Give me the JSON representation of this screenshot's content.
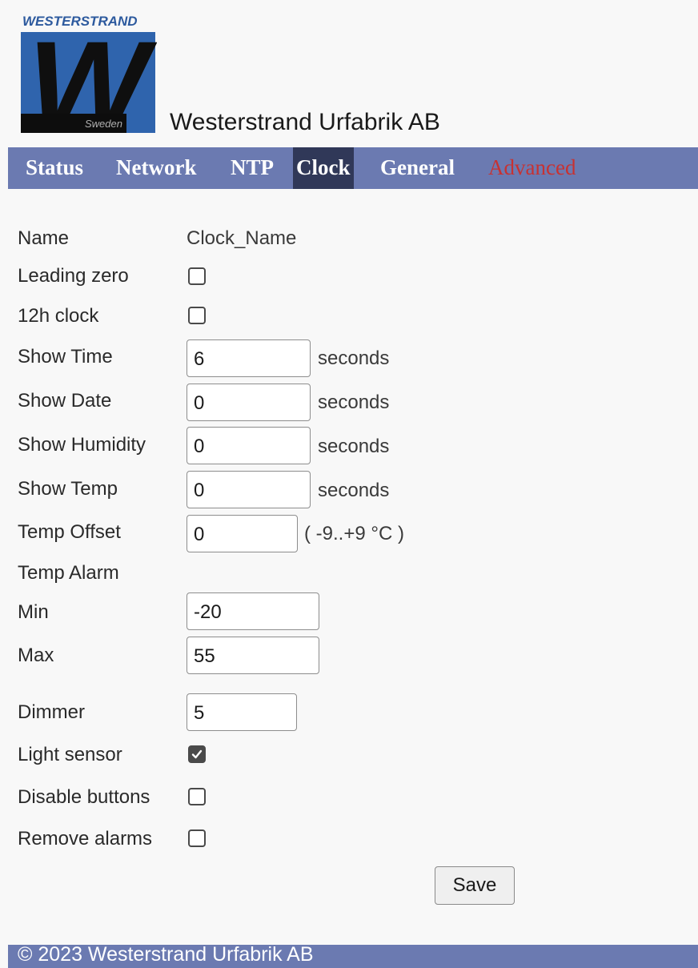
{
  "header": {
    "logo_top_text": "WESTERSTRAND",
    "logo_letter": "W",
    "logo_bottom_text": "Sweden",
    "site_title": "Westerstrand Urfabrik AB"
  },
  "nav": {
    "items": [
      {
        "label": "Status"
      },
      {
        "label": "Network"
      },
      {
        "label": "NTP"
      },
      {
        "label": "Clock",
        "active": true
      },
      {
        "label": "General"
      },
      {
        "label": "Advanced"
      }
    ],
    "bar_color": "#6b7ab1",
    "active_color": "#303858",
    "advanced_color": "#c73232"
  },
  "form": {
    "name_label": "Name",
    "name_value": "Clock_Name",
    "leading_zero_label": "Leading zero",
    "leading_zero_checked": false,
    "twelve_h_label": "12h clock",
    "twelve_h_checked": false,
    "show_time_label": "Show Time",
    "show_time_value": "6",
    "show_date_label": "Show Date",
    "show_date_value": "0",
    "show_humidity_label": "Show Humidity",
    "show_humidity_value": "0",
    "show_temp_label": "Show Temp",
    "show_temp_value": "0",
    "seconds_unit": "seconds",
    "temp_offset_label": "Temp Offset",
    "temp_offset_value": "0",
    "temp_offset_range": "( -9..+9 °C )",
    "temp_alarm_label": "Temp Alarm",
    "min_label": "Min",
    "min_value": "-20",
    "max_label": "Max",
    "max_value": "55",
    "dimmer_label": "Dimmer",
    "dimmer_value": "5",
    "light_sensor_label": "Light sensor",
    "light_sensor_checked": true,
    "disable_buttons_label": "Disable buttons",
    "disable_buttons_checked": false,
    "remove_alarms_label": "Remove alarms",
    "remove_alarms_checked": false,
    "save_label": "Save"
  },
  "footer": {
    "text": "© 2023 Westerstrand Urfabrik AB"
  }
}
